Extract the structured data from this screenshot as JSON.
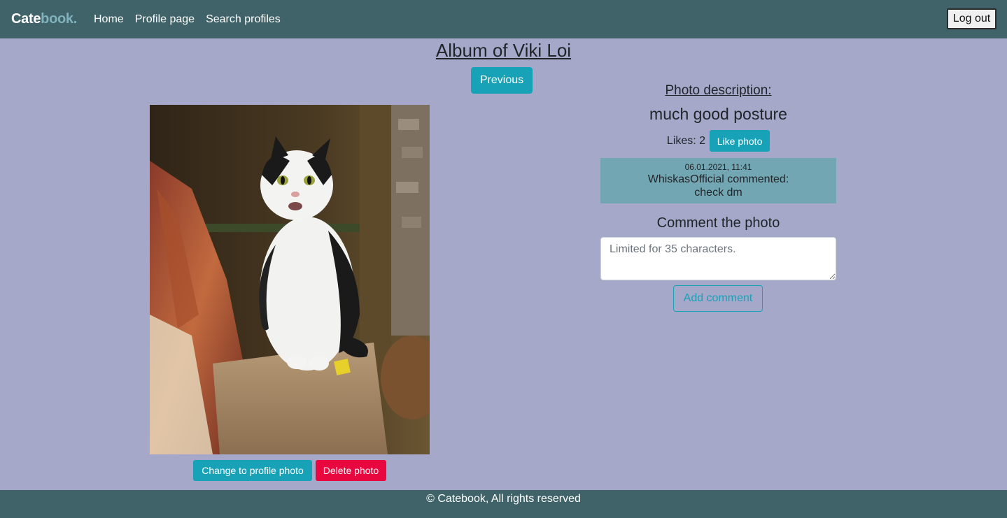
{
  "navbar": {
    "brand_part1": "Cate",
    "brand_part2": "book.",
    "links": [
      "Home",
      "Profile page",
      "Search profiles"
    ],
    "logout_label": "Log out"
  },
  "album": {
    "title": "Album of Viki Loi",
    "previous_label": "Previous"
  },
  "photo": {
    "alt": "White and black cat sitting on a cardboard box",
    "change_profile_label": "Change to profile photo",
    "delete_label": "Delete photo"
  },
  "description": {
    "heading": "Photo description:",
    "text": "much good posture",
    "likes_label": "Likes: 2",
    "like_button_label": "Like photo"
  },
  "comments": [
    {
      "timestamp": "06.01.2021, 11:41",
      "author_line": "WhiskasOfficial commented:",
      "text": "check dm"
    }
  ],
  "comment_form": {
    "heading": "Comment the photo",
    "placeholder": "Limited for 35 characters.",
    "submit_label": "Add comment"
  },
  "footer": {
    "text": "© Catebook, All rights reserved"
  },
  "colors": {
    "navbar": "#3f6369",
    "page_background": "#a5a8c9",
    "accent": "#17a2b8",
    "danger": "#e8073f",
    "comment_background": "#72a6b2"
  }
}
